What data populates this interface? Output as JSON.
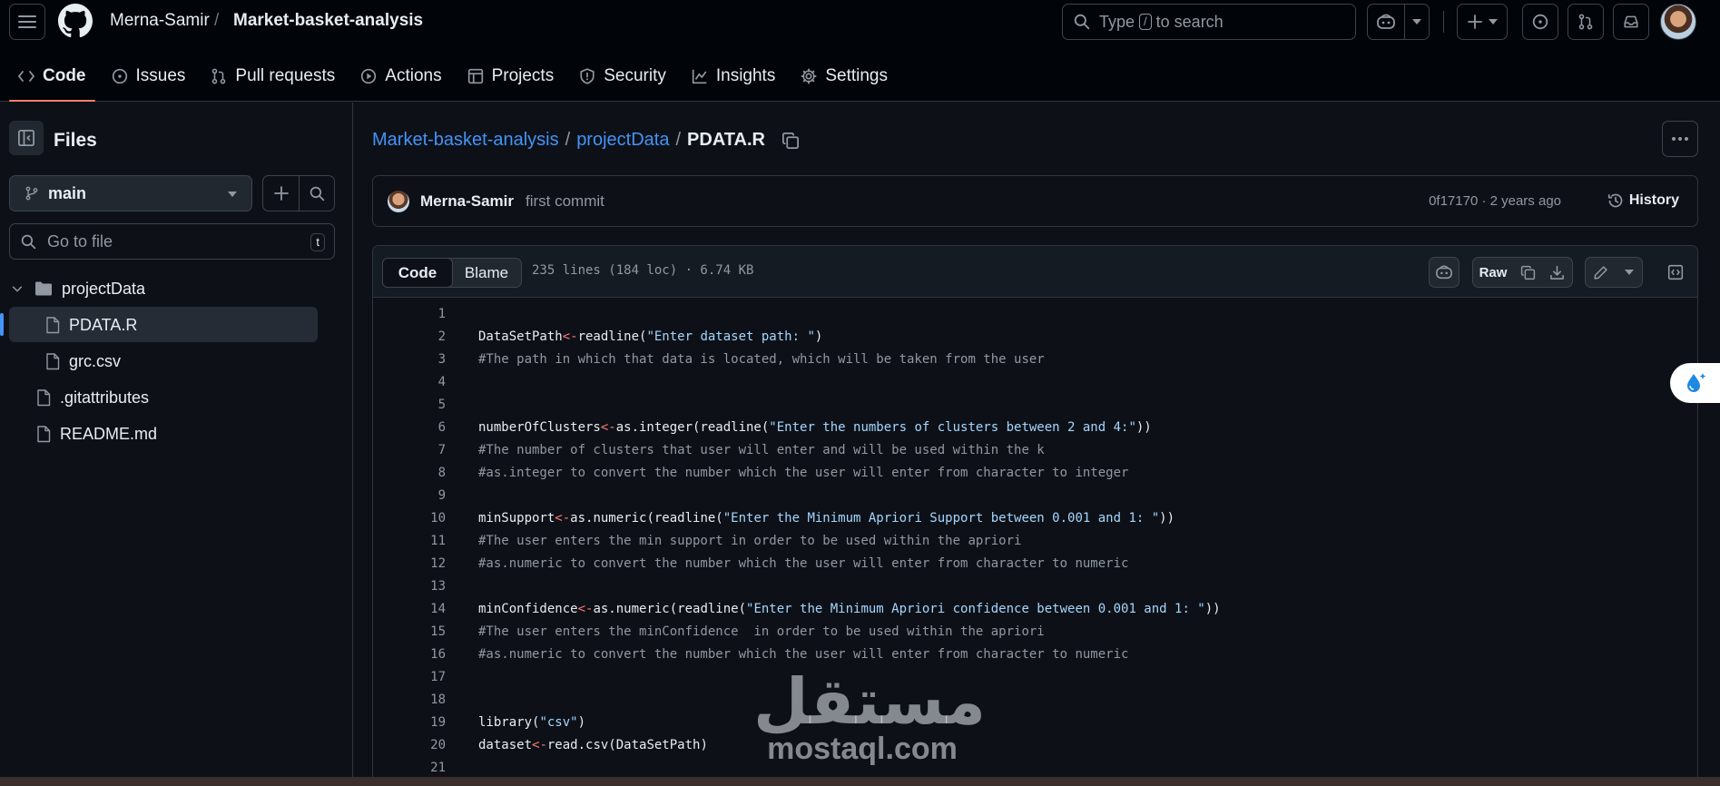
{
  "header": {
    "owner": "Merna-Samir",
    "separator": "/",
    "repo": "Market-basket-analysis",
    "search_prefix": "Type",
    "search_key": "/",
    "search_suffix": "to search"
  },
  "tabs": [
    {
      "label": "Code",
      "icon": "code-icon",
      "active": true
    },
    {
      "label": "Issues",
      "icon": "issue-opened-icon"
    },
    {
      "label": "Pull requests",
      "icon": "git-pull-request-icon"
    },
    {
      "label": "Actions",
      "icon": "play-icon"
    },
    {
      "label": "Projects",
      "icon": "table-icon"
    },
    {
      "label": "Security",
      "icon": "shield-icon"
    },
    {
      "label": "Insights",
      "icon": "graph-icon"
    },
    {
      "label": "Settings",
      "icon": "gear-icon"
    }
  ],
  "sidebar": {
    "title": "Files",
    "branch": "main",
    "goto_placeholder": "Go to file",
    "goto_key": "t",
    "tree": [
      {
        "label": "projectData",
        "type": "folder",
        "expanded": true
      },
      {
        "label": "PDATA.R",
        "type": "file",
        "selected": true
      },
      {
        "label": "grc.csv",
        "type": "file"
      },
      {
        "label": ".gitattributes",
        "type": "file"
      },
      {
        "label": "README.md",
        "type": "file"
      }
    ]
  },
  "breadcrumb": {
    "repo": "Market-basket-analysis",
    "sep": "/",
    "folder": "projectData",
    "file": "PDATA.R"
  },
  "commit": {
    "author": "Merna-Samir",
    "message": "first commit",
    "meta": "0f17170 · 2 years ago",
    "history_label": "History"
  },
  "file": {
    "tab_code": "Code",
    "tab_blame": "Blame",
    "info": "235 lines (184 loc) · 6.74 KB",
    "raw_label": "Raw"
  },
  "code_lines": [
    {
      "n": "1",
      "parts": []
    },
    {
      "n": "2",
      "parts": [
        {
          "t": "DataSetPath"
        },
        {
          "t": "<-",
          "k": "o"
        },
        {
          "t": "readline("
        },
        {
          "t": "\"Enter dataset path: \"",
          "k": "s"
        },
        {
          "t": ")"
        }
      ]
    },
    {
      "n": "3",
      "parts": [
        {
          "t": "#The path in which that data is located, which will be taken from the user",
          "k": "c"
        }
      ]
    },
    {
      "n": "4",
      "parts": []
    },
    {
      "n": "5",
      "parts": []
    },
    {
      "n": "6",
      "parts": [
        {
          "t": "numberOfClusters"
        },
        {
          "t": "<-",
          "k": "o"
        },
        {
          "t": "as.integer(readline("
        },
        {
          "t": "\"Enter the numbers of clusters between 2 and 4:\"",
          "k": "s"
        },
        {
          "t": "))"
        }
      ]
    },
    {
      "n": "7",
      "parts": [
        {
          "t": "#The number of clusters that user will enter and will be used within the k",
          "k": "c"
        }
      ]
    },
    {
      "n": "8",
      "parts": [
        {
          "t": "#as.integer to convert the number which the user will enter from character to integer",
          "k": "c"
        }
      ]
    },
    {
      "n": "9",
      "parts": []
    },
    {
      "n": "10",
      "parts": [
        {
          "t": "minSupport"
        },
        {
          "t": "<-",
          "k": "o"
        },
        {
          "t": "as.numeric(readline("
        },
        {
          "t": "\"Enter the Minimum Apriori Support between 0.001 and 1: \"",
          "k": "s"
        },
        {
          "t": "))"
        }
      ]
    },
    {
      "n": "11",
      "parts": [
        {
          "t": "#The user enters the min support in order to be used within the apriori",
          "k": "c"
        }
      ]
    },
    {
      "n": "12",
      "parts": [
        {
          "t": "#as.numeric to convert the number which the user will enter from character to numeric",
          "k": "c"
        }
      ]
    },
    {
      "n": "13",
      "parts": []
    },
    {
      "n": "14",
      "parts": [
        {
          "t": "minConfidence"
        },
        {
          "t": "<-",
          "k": "o"
        },
        {
          "t": "as.numeric(readline("
        },
        {
          "t": "\"Enter the Minimum Apriori confidence between 0.001 and 1: \"",
          "k": "s"
        },
        {
          "t": "))"
        }
      ]
    },
    {
      "n": "15",
      "parts": [
        {
          "t": "#The user enters the minConfidence  in order to be used within the apriori",
          "k": "c"
        }
      ]
    },
    {
      "n": "16",
      "parts": [
        {
          "t": "#as.numeric to convert the number which the user will enter from character to numeric",
          "k": "c"
        }
      ]
    },
    {
      "n": "17",
      "parts": []
    },
    {
      "n": "18",
      "parts": []
    },
    {
      "n": "19",
      "parts": [
        {
          "t": "library("
        },
        {
          "t": "\"csv\"",
          "k": "s"
        },
        {
          "t": ")"
        }
      ]
    },
    {
      "n": "20",
      "parts": [
        {
          "t": "dataset"
        },
        {
          "t": "<-",
          "k": "o"
        },
        {
          "t": "read.csv(DataSetPath)"
        }
      ]
    },
    {
      "n": "21",
      "parts": []
    }
  ],
  "watermark": {
    "arabic": "مستقل",
    "latin": "mostaql.com"
  }
}
